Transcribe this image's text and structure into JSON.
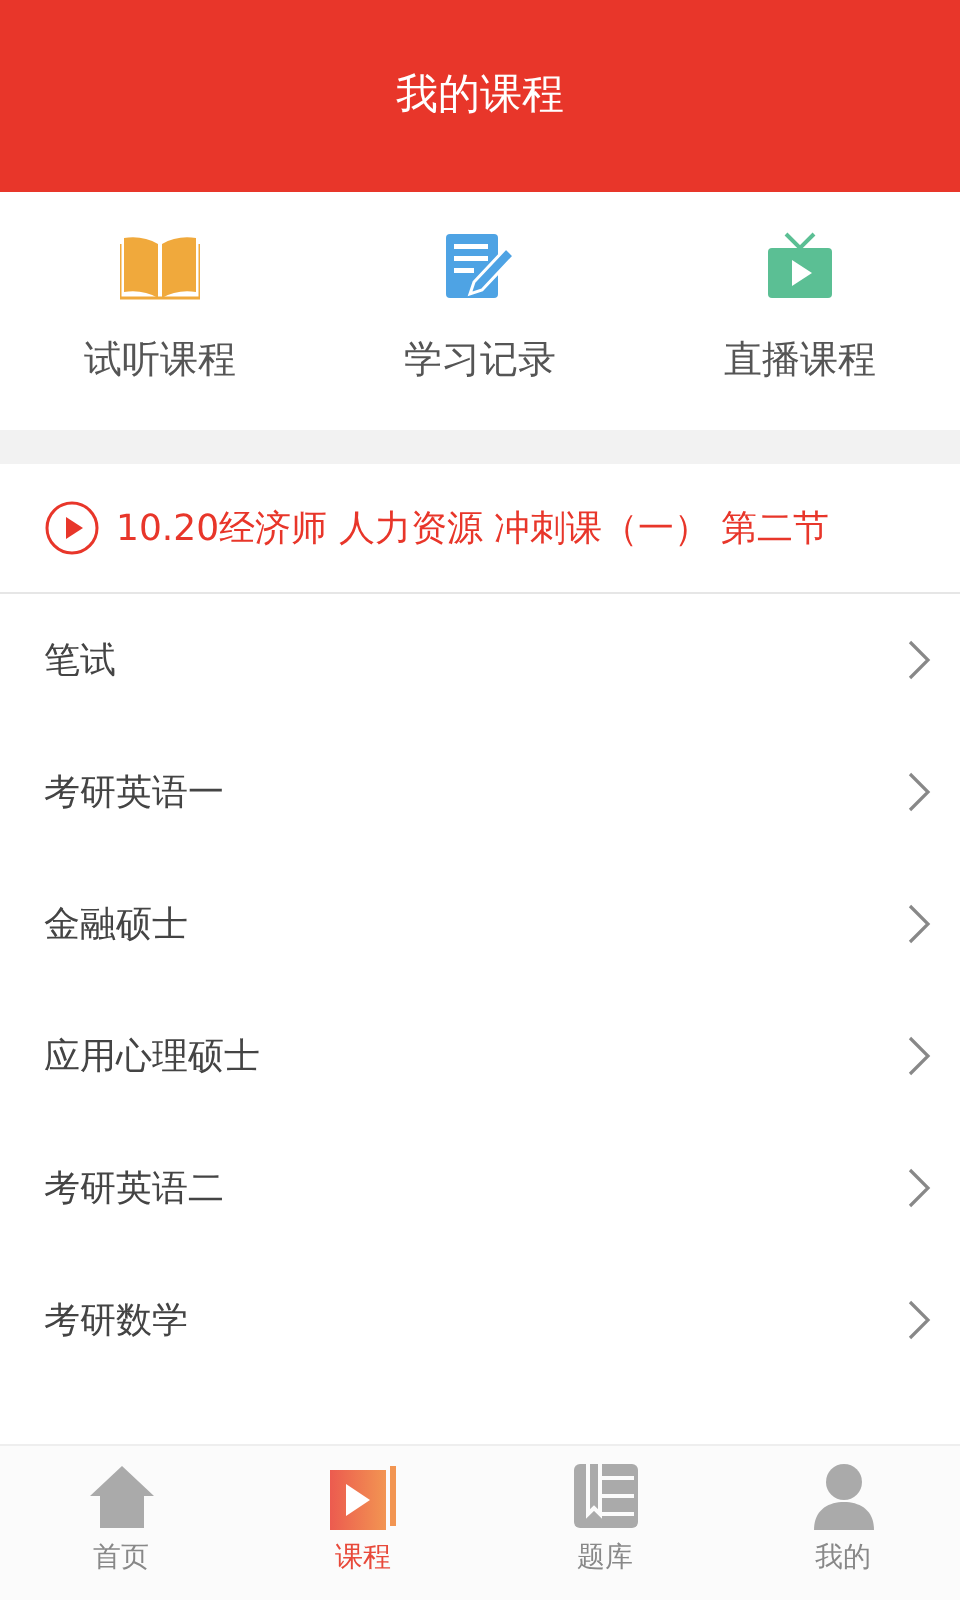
{
  "header": {
    "title": "我的课程"
  },
  "shortcuts": [
    {
      "kind": "book",
      "label": "试听课程"
    },
    {
      "kind": "notes",
      "label": "学习记录"
    },
    {
      "kind": "tv",
      "label": "直播课程"
    }
  ],
  "current_lesson": {
    "title": "10.20经济师 人力资源 冲刺课（一） 第二节"
  },
  "categories": [
    {
      "label": "笔试"
    },
    {
      "label": "考研英语一"
    },
    {
      "label": "金融硕士"
    },
    {
      "label": "应用心理硕士"
    },
    {
      "label": "考研英语二"
    },
    {
      "label": "考研数学"
    }
  ],
  "tabbar": [
    {
      "kind": "home",
      "label": "首页",
      "selected": false
    },
    {
      "kind": "course",
      "label": "课程",
      "selected": true
    },
    {
      "kind": "bank",
      "label": "题库",
      "selected": false
    },
    {
      "kind": "me",
      "label": "我的",
      "selected": false
    }
  ]
}
